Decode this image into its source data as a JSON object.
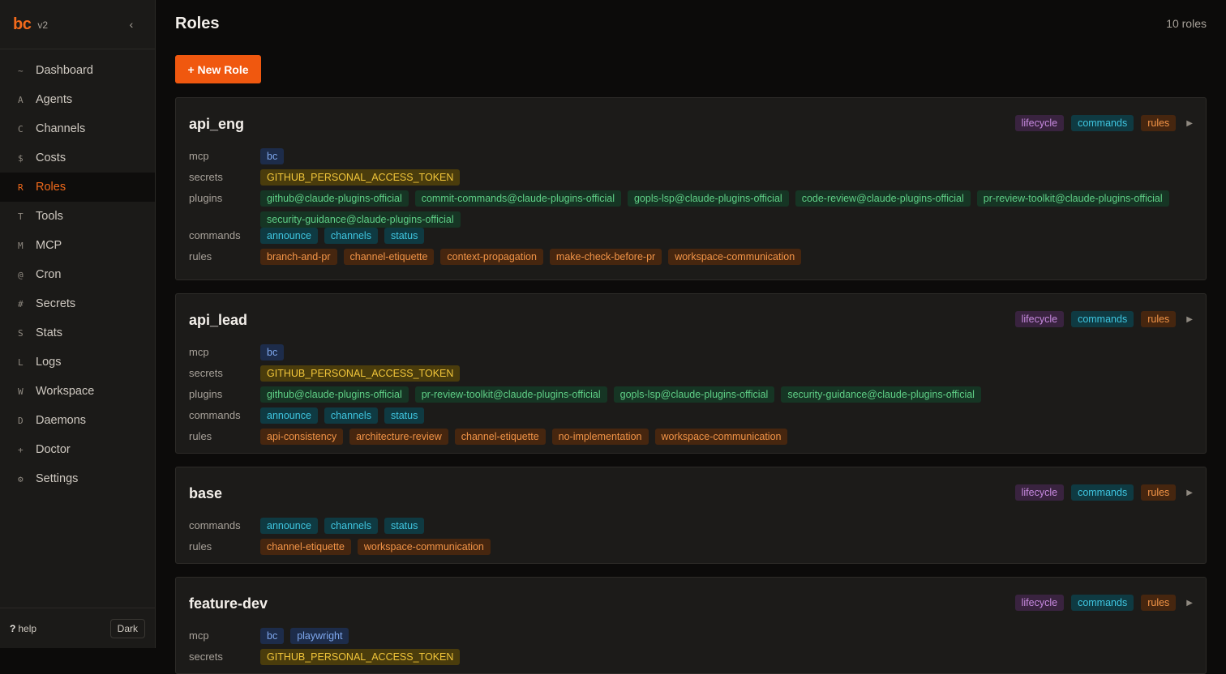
{
  "brand": {
    "logo": "bc",
    "version": "v2",
    "collapse_glyph": "‹"
  },
  "nav": [
    {
      "glyph": "~",
      "label": "Dashboard"
    },
    {
      "glyph": "A",
      "label": "Agents"
    },
    {
      "glyph": "C",
      "label": "Channels"
    },
    {
      "glyph": "$",
      "label": "Costs"
    },
    {
      "glyph": "R",
      "label": "Roles",
      "active": true
    },
    {
      "glyph": "T",
      "label": "Tools"
    },
    {
      "glyph": "M",
      "label": "MCP"
    },
    {
      "glyph": "@",
      "label": "Cron"
    },
    {
      "glyph": "#",
      "label": "Secrets"
    },
    {
      "glyph": "S",
      "label": "Stats"
    },
    {
      "glyph": "L",
      "label": "Logs"
    },
    {
      "glyph": "W",
      "label": "Workspace"
    },
    {
      "glyph": "D",
      "label": "Daemons"
    },
    {
      "glyph": "+",
      "label": "Doctor"
    },
    {
      "glyph": "⚙",
      "label": "Settings"
    }
  ],
  "footer": {
    "help_key": "?",
    "help_label": "help",
    "theme": "Dark"
  },
  "header": {
    "title": "Roles",
    "count": "10 roles",
    "new_button": "+ New Role"
  },
  "card_header_tags": {
    "lifecycle": "lifecycle",
    "commands": "commands",
    "rules": "rules",
    "expand": "▶"
  },
  "roles": [
    {
      "name": "api_eng",
      "rows": [
        {
          "label": "mcp",
          "kind": "mcp",
          "tags": [
            "bc"
          ]
        },
        {
          "label": "secrets",
          "kind": "secret",
          "tags": [
            "GITHUB_PERSONAL_ACCESS_TOKEN"
          ]
        },
        {
          "label": "plugins",
          "kind": "plugin",
          "tags": [
            "github@claude-plugins-official",
            "commit-commands@claude-plugins-official",
            "gopls-lsp@claude-plugins-official",
            "code-review@claude-plugins-official",
            "pr-review-toolkit@claude-plugins-official",
            "security-guidance@claude-plugins-official"
          ]
        },
        {
          "label": "commands",
          "kind": "cmd",
          "tags": [
            "announce",
            "channels",
            "status"
          ]
        },
        {
          "label": "rules",
          "kind": "rule",
          "tags": [
            "branch-and-pr",
            "channel-etiquette",
            "context-propagation",
            "make-check-before-pr",
            "workspace-communication"
          ]
        }
      ]
    },
    {
      "name": "api_lead",
      "rows": [
        {
          "label": "mcp",
          "kind": "mcp",
          "tags": [
            "bc"
          ]
        },
        {
          "label": "secrets",
          "kind": "secret",
          "tags": [
            "GITHUB_PERSONAL_ACCESS_TOKEN"
          ]
        },
        {
          "label": "plugins",
          "kind": "plugin",
          "tags": [
            "github@claude-plugins-official",
            "pr-review-toolkit@claude-plugins-official",
            "gopls-lsp@claude-plugins-official",
            "security-guidance@claude-plugins-official"
          ]
        },
        {
          "label": "commands",
          "kind": "cmd",
          "tags": [
            "announce",
            "channels",
            "status"
          ]
        },
        {
          "label": "rules",
          "kind": "rule",
          "tags": [
            "api-consistency",
            "architecture-review",
            "channel-etiquette",
            "no-implementation",
            "workspace-communication"
          ]
        }
      ]
    },
    {
      "name": "base",
      "rows": [
        {
          "label": "commands",
          "kind": "cmd",
          "tags": [
            "announce",
            "channels",
            "status"
          ]
        },
        {
          "label": "rules",
          "kind": "rule",
          "tags": [
            "channel-etiquette",
            "workspace-communication"
          ]
        }
      ]
    },
    {
      "name": "feature-dev",
      "rows": [
        {
          "label": "mcp",
          "kind": "mcp",
          "tags": [
            "bc",
            "playwright"
          ]
        },
        {
          "label": "secrets",
          "kind": "secret",
          "tags": [
            "GITHUB_PERSONAL_ACCESS_TOKEN"
          ]
        }
      ]
    }
  ]
}
